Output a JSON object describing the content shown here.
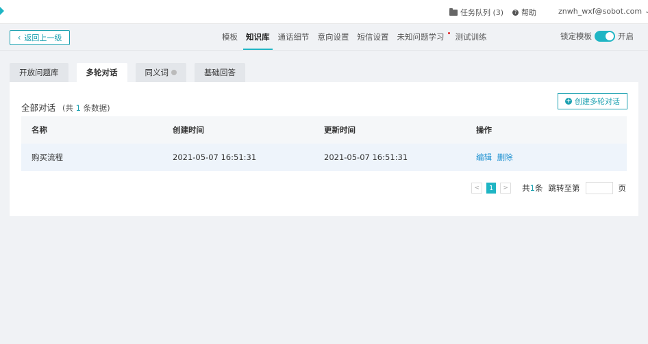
{
  "topbar": {
    "queue_label": "任务队列 (3)",
    "help_label": "帮助",
    "user_email": "znwh_wxf@sobot.com",
    "caret": "⌄"
  },
  "nav": {
    "back_label": "返回上一级",
    "tabs": [
      {
        "label": "模板"
      },
      {
        "label": "知识库"
      },
      {
        "label": "通话细节"
      },
      {
        "label": "意向设置"
      },
      {
        "label": "短信设置"
      },
      {
        "label": "未知问题学习"
      },
      {
        "label": "测试训练"
      }
    ],
    "lock_label": "锁定模板",
    "lock_state": "开启"
  },
  "subtabs": [
    {
      "label": "开放问题库"
    },
    {
      "label": "多轮对话"
    },
    {
      "label": "同义词"
    },
    {
      "label": "基础回答"
    }
  ],
  "panel": {
    "title": "全部对话",
    "count_prefix": "(共",
    "count_num": "1",
    "count_suffix": "条数据)",
    "create_label": "创建多轮对话"
  },
  "table": {
    "headers": [
      "名称",
      "创建时间",
      "更新时间",
      "操作"
    ],
    "rows": [
      {
        "name": "购买流程",
        "created": "2021-05-07 16:51:31",
        "updated": "2021-05-07 16:51:31",
        "edit": "编辑",
        "delete": "删除"
      }
    ]
  },
  "pager": {
    "prev": "<",
    "page": "1",
    "next": ">",
    "total_prefix": "共",
    "total_num": "1",
    "total_suffix": "条",
    "jump_label": "跳转至第",
    "page_suffix": "页"
  },
  "colors": {
    "accent": "#1fb5c4",
    "link": "#1a8fd0",
    "badge_dot": "#e02020"
  }
}
